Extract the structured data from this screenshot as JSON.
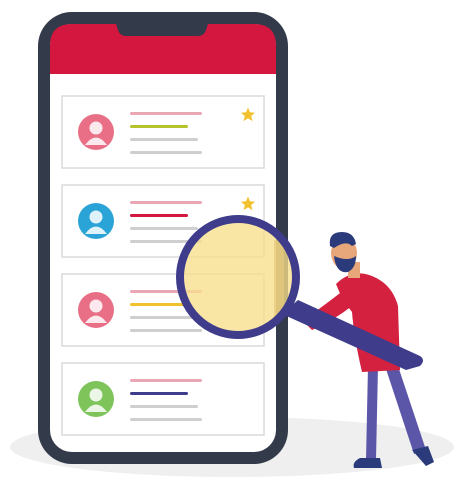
{
  "colors": {
    "phone_frame": "#333a4a",
    "phone_header": "#d3173f",
    "screen_bg": "#ffffff",
    "card_border": "#dadada",
    "star": "#f2c12e",
    "ground": "#efefef",
    "magnifier_rim": "#3f3c8b",
    "magnifier_glass": "#f7df8c",
    "person_shirt": "#d4213f",
    "person_pants": "#5c56a8",
    "person_skin": "#e8a77b",
    "person_hair": "#2b3a7a"
  },
  "cards": [
    {
      "avatar_color": "#e86f86",
      "starred": true,
      "line_colors": [
        "#e8a7b3",
        "#b5c42c",
        "#cfcfcf",
        "#cfcfcf"
      ]
    },
    {
      "avatar_color": "#2aa3d6",
      "starred": true,
      "line_colors": [
        "#e8a7b3",
        "#d3173f",
        "#cfcfcf",
        "#cfcfcf"
      ]
    },
    {
      "avatar_color": "#e86f86",
      "starred": false,
      "line_colors": [
        "#e8a7b3",
        "#f2c12e",
        "#cfcfcf",
        "#cfcfcf"
      ]
    },
    {
      "avatar_color": "#7fc45a",
      "starred": false,
      "line_colors": [
        "#e8a7b3",
        "#3f3c8b",
        "#cfcfcf",
        "#cfcfcf"
      ]
    }
  ]
}
